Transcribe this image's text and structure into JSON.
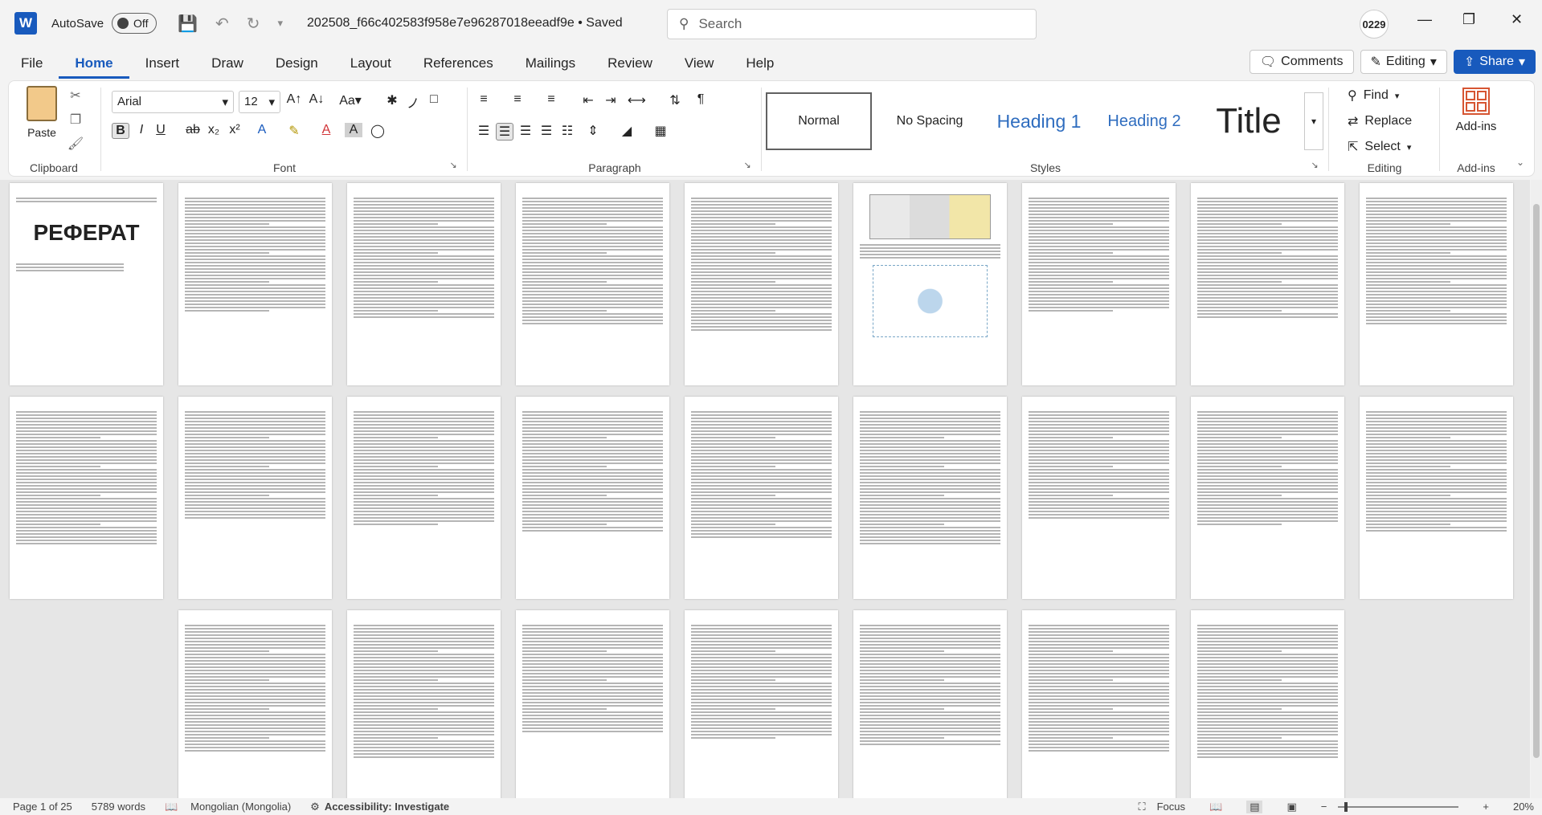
{
  "app": {
    "autosave_label": "AutoSave",
    "autosave_state": "Off",
    "doc_title": "202508_f66c402583f958e7e96287018eeadf9e • Saved",
    "search_placeholder": "Search",
    "user_initials": "0229",
    "brand_color": "#185abd"
  },
  "menu": {
    "tabs": [
      "File",
      "Home",
      "Insert",
      "Draw",
      "Design",
      "Layout",
      "References",
      "Mailings",
      "Review",
      "View",
      "Help"
    ],
    "active": "Home",
    "comments": "Comments",
    "editing": "Editing",
    "share": "Share"
  },
  "ribbon": {
    "clipboard": {
      "label": "Clipboard",
      "paste": "Paste"
    },
    "font": {
      "label": "Font",
      "family": "Arial",
      "size": "12"
    },
    "paragraph": {
      "label": "Paragraph"
    },
    "styles": {
      "label": "Styles",
      "items": [
        "Normal",
        "No Spacing",
        "Heading 1",
        "Heading 2",
        "Title"
      ]
    },
    "editing": {
      "label": "Editing",
      "find": "Find",
      "replace": "Replace",
      "select": "Select"
    },
    "addins": {
      "label": "Add-ins",
      "button": "Add-ins"
    }
  },
  "document": {
    "cover_title": "РЕФЕРАТ",
    "page_count": 25
  },
  "status": {
    "page": "Page 1 of 25",
    "words": "5789 words",
    "language": "Mongolian (Mongolia)",
    "accessibility": "Accessibility: Investigate",
    "focus": "Focus",
    "zoom": "20%"
  }
}
